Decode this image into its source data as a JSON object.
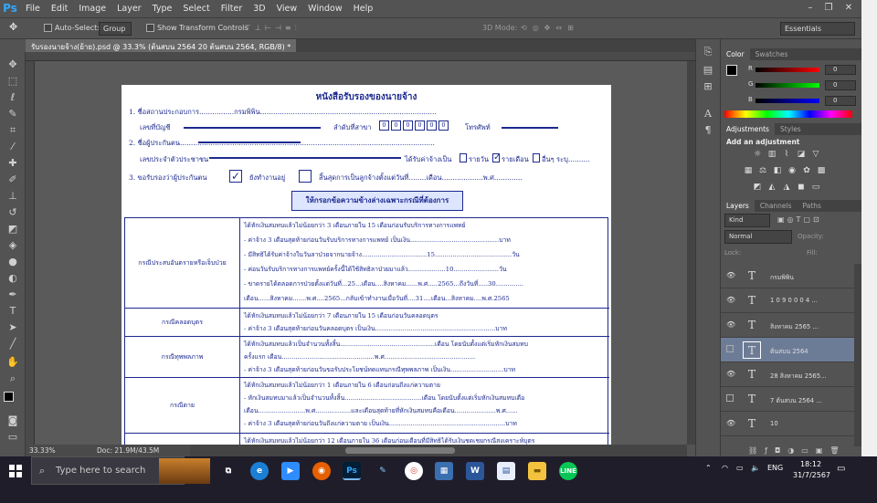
{
  "app": {
    "logo": "Ps",
    "menus": [
      "File",
      "Edit",
      "Image",
      "Layer",
      "Type",
      "Select",
      "Filter",
      "3D",
      "View",
      "Window",
      "Help"
    ]
  },
  "options": {
    "auto_select": "Auto-Select:",
    "group": "Group",
    "show_transform": "Show Transform Controls",
    "mode3d": "3D Mode:",
    "workspace": "Essentials"
  },
  "document": {
    "tab_title": "รับรองนายจ้าง(ย้าย).psd @ 33.3% (ต้นสบน    2564     20   ต้นสบน    2564, RGB/8) *",
    "title": "หนังสือรับรองของนายจ้าง",
    "line1": "1. ชื่อสถานประกอบการ................กรมพิพิน.................................................................................",
    "line1b": "เลขที่บัญชี",
    "line1c": "ลำดับที่สาขา",
    "line1d": "โทรศัพท์",
    "branch_digits": [
      "0",
      "0",
      "0",
      "0",
      "0",
      "0"
    ],
    "line2": "2. ชื่อผู้ประกันตน.....................................................................................................................",
    "line2b": "เลขประจำตัวประชาชน",
    "line2c": "ได้รับค่าจ้างเป็น",
    "line2d": "รายวัน",
    "line2e": "รายเดือน",
    "line2f": "อื่นๆ ระบุ..........",
    "line3": "3. ขอรับรองว่าผู้ประกันตน",
    "line3b": "ยังทำงานอยู่",
    "line3c": "สิ้นสุดการเป็นลูกจ้างตั้งแต่วันที่........เดือน...................พ.ศ.............",
    "notice": "ให้กรอกข้อความข้างล่างเฉพาะกรณีที่ต้องการ",
    "rows": [
      {
        "label": "กรณีประสบอันตรายหรือเจ็บป่วย",
        "lines": [
          "ได้หักเงินสมทบแล้วไม่น้อยกว่า 3 เดือนภายใน 15 เดือนก่อนรับบริการทางการแพทย์",
          "- ค่าจ้าง 3 เดือนสุดท้ายก่อนวันรับบริการทางการแพทย์ เป็นเงิน.............................................บาท",
          "- มีสิทธิได้รับค่าจ้างในวันลาป่วยจากนายจ้าง.................................15.......................................วัน",
          "- ค่อนวันรับบริการทางการแพทย์ครั้งนี้ได้ใช้สิทธิลาป่วยมาแล้ว...................10.......................วัน",
          "- ขาดรายได้ตลอดการป่วยตั้งแต่วันที่...25...เดือน....สิงหาคม......พ.ศ.....2565...ถึงวันที่.....30..............",
          "  เดือน......สิงหาคม.......พ.ศ....2565...กลับเข้าทำงานเมื่อวันที่....31....เดือน...สิงหาคม....พ.ศ.2565"
        ]
      },
      {
        "label": "กรณีคลอดบุตร",
        "lines": [
          "ได้หักเงินสมทบแล้วไม่น้อยกว่า 7 เดือนภายใน 15 เดือนก่อนวันคลอดบุตร",
          "- ค่าจ้าง 3 เดือนสุดท้ายก่อนวันคลอดบุตร เป็นเงิน.............................................................บาท"
        ]
      },
      {
        "label": "กรณีทุพพลภาพ",
        "lines": [
          "ได้หักเงินสมทบแล้วเป็นจำนวนทั้งสิ้น................................................เดือน โดยนับตั้งแต่เริ่มหักเงินสมทบ",
          "ครั้งแรก เดือน...............................................พ.ศ..............................................",
          "- ค่าจ้าง 3 เดือนสุดท้ายก่อนวันขอรับประโยชน์ทดแทนกรณีทุพพลภาพ เป็นเงิน...........................บาท"
        ]
      },
      {
        "label": "กรณีตาย",
        "lines": [
          "ได้หักเงินสมทบแล้วไม่น้อยกว่า 1 เดือนภายใน 6 เดือนก่อนถึงแก่ความตาย",
          "- หักเงินสมทบมาแล้วเป็นจำนวนทั้งสิ้น.......................................เดือน โดยนับตั้งแต่เริ่มหักเงินสมทบเดือ",
          "  เดือน........................พ.ศ..................และเดือนสุดท้ายที่หักเงินสมทบคือเดือน.....................พ.ศ......",
          "- ค่าจ้าง 3 เดือนสุดท้ายก่อนวันถึงแก่ความตาย เป็นเงิน...........................................................บาท"
        ]
      },
      {
        "label": "",
        "lines": [
          "ได้หักเงินสมทบแล้วไม่น้อยกว่า 12 เดือนภายใน 36 เดือนก่อนเดือนที่มีสิทธิได้รับเงินชดเชยกรณีสงเคราะห์บุตร"
        ]
      }
    ]
  },
  "status": {
    "zoom": "33.33%",
    "doc": "Doc: 21.9M/43.5M"
  },
  "panels": {
    "color_tabs": [
      "Color",
      "Swatches"
    ],
    "rgb": [
      {
        "ch": "R",
        "val": "0"
      },
      {
        "ch": "G",
        "val": "0"
      },
      {
        "ch": "B",
        "val": "0"
      }
    ],
    "adj_tabs": [
      "Adjustments",
      "Styles"
    ],
    "adj_title": "Add an adjustment",
    "layer_tabs": [
      "Layers",
      "Channels",
      "Paths"
    ],
    "kind": "Kind",
    "blend": "Normal",
    "opacity_label": "Opacity:",
    "lock_label": "Lock:",
    "fill_label": "Fill:",
    "layers": [
      {
        "name": "กรมพิพิน",
        "selected": false,
        "visible": true
      },
      {
        "name": "1 0   9 0 0 0 4 ...",
        "selected": false,
        "visible": true
      },
      {
        "name": "สิงหาคม     2565      ...",
        "selected": false,
        "visible": true
      },
      {
        "name": "ต้นสบน     2564",
        "selected": true,
        "visible": false
      },
      {
        "name": "28   สิงหาคม     2565...",
        "selected": false,
        "visible": true
      },
      {
        "name": "7     ต้นสบน       2564 ...",
        "selected": false,
        "visible": false
      },
      {
        "name": "10",
        "selected": false,
        "visible": true
      }
    ]
  },
  "taskbar": {
    "search_placeholder": "Type here to search",
    "lang": "ENG",
    "time": "18:12",
    "date": "31/7/2567"
  }
}
